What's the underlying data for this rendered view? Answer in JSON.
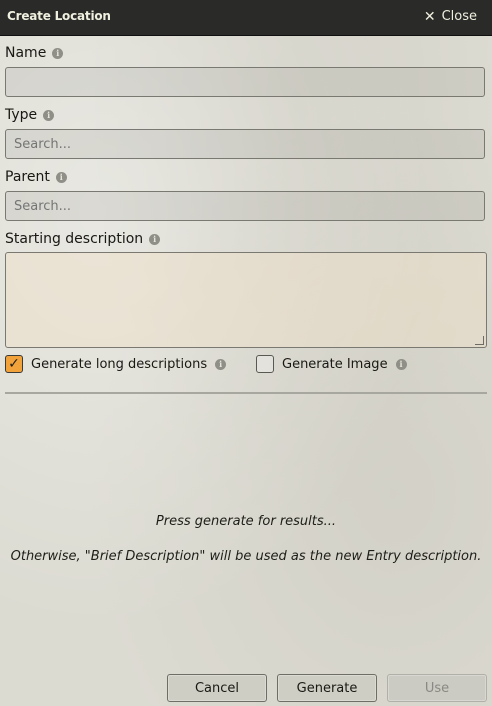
{
  "window": {
    "title": "Create Location",
    "close_label": "Close"
  },
  "form": {
    "name": {
      "label": "Name",
      "value": ""
    },
    "type": {
      "label": "Type",
      "placeholder": "Search..."
    },
    "parent": {
      "label": "Parent",
      "placeholder": "Search..."
    },
    "starting_description": {
      "label": "Starting description",
      "value": ""
    },
    "generate_long": {
      "label": "Generate long descriptions",
      "checked": true
    },
    "generate_image": {
      "label": "Generate Image",
      "checked": false
    }
  },
  "results": {
    "line1": "Press generate for results...",
    "line2": "Otherwise, \"Brief Description\" will be used as the new Entry description."
  },
  "buttons": {
    "cancel": "Cancel",
    "generate": "Generate",
    "use": "Use"
  },
  "icons": {
    "info": "i",
    "close": "✕",
    "check": "✓"
  },
  "colors": {
    "titlebar": "#2a2a28",
    "checkbox_checked": "#f2a23a"
  }
}
